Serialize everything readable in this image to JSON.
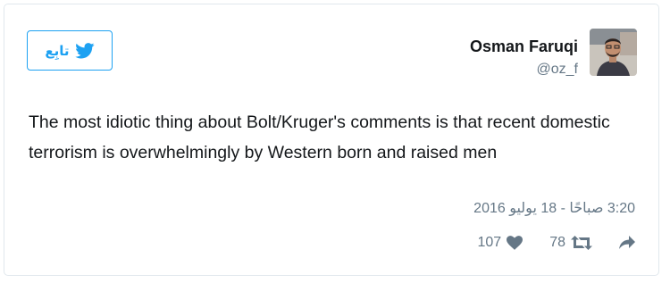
{
  "tweet": {
    "follow_label": "تابِع",
    "author_name": "Osman Faruqi",
    "author_handle": "@oz_f",
    "text": "The most idiotic thing about Bolt/Kruger's comments is that recent domestic terrorism is overwhelmingly by Western born and raised men",
    "timestamp": "3:20 صباحًا - 18 يوليو 2016",
    "like_count": "107",
    "retweet_count": "78"
  },
  "icons": {
    "follow": "twitter-bird-icon",
    "like": "heart-icon",
    "retweet": "retweet-icon",
    "share": "share-arrow-icon"
  },
  "colors": {
    "accent": "#1da1f2",
    "muted": "#657786",
    "text": "#14171a",
    "border": "#e1e8ed"
  }
}
